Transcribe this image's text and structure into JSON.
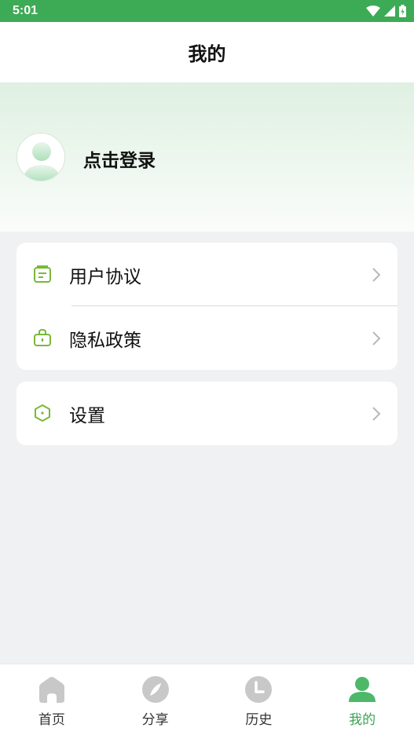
{
  "status_bar": {
    "time": "5:01"
  },
  "app_bar": {
    "title": "我的"
  },
  "profile": {
    "login_label": "点击登录"
  },
  "menu": {
    "user_agreement": "用户协议",
    "privacy_policy": "隐私政策",
    "settings": "设置"
  },
  "bottom_nav": {
    "items": [
      {
        "label": "首页",
        "icon": "home-icon"
      },
      {
        "label": "分享",
        "icon": "compass-icon"
      },
      {
        "label": "历史",
        "icon": "clock-icon"
      },
      {
        "label": "我的",
        "icon": "user-icon",
        "active": true
      }
    ]
  },
  "colors": {
    "brand": "#3daa55",
    "active_nav": "#3aa451",
    "inactive_nav_icon": "#c8c8c8",
    "menu_icon": "#7ab83a"
  }
}
